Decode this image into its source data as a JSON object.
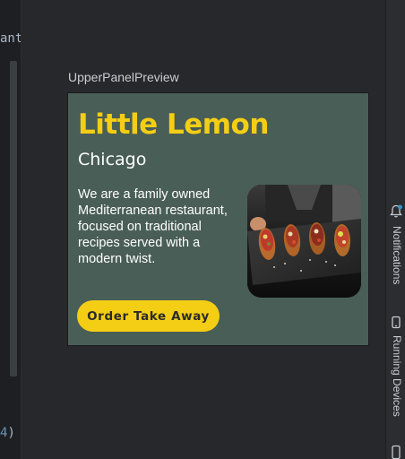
{
  "editor": {
    "code_fragment_top": "ant",
    "code_fragment_bottom_num": "4",
    "code_fragment_bottom_paren": ")"
  },
  "preview": {
    "name": "UpperPanelPreview",
    "card": {
      "title": "Little Lemon",
      "subtitle": "Chicago",
      "description": "We are a family owned Mediterranean restaurant, focused on traditional recipes served with a modern twist.",
      "button_label": "Order Take Away",
      "image": "food-dish-photo"
    },
    "colors": {
      "background": "#495e57",
      "title": "#f4ce14",
      "button": "#f4ce14",
      "text": "#ffffff"
    }
  },
  "tool_windows": {
    "notifications": {
      "label": "Notifications",
      "icon": "bell-icon"
    },
    "running_devices": {
      "label": "Running Devices",
      "icon": "device-icon"
    },
    "bottom": {
      "icon": "device-icon"
    }
  }
}
